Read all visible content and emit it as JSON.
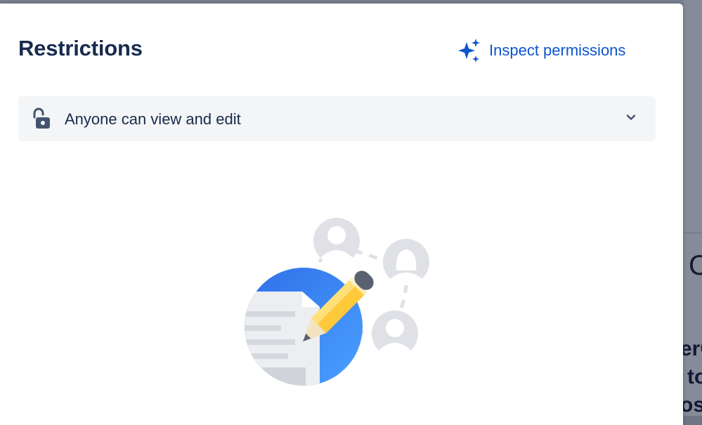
{
  "dialog": {
    "title": "Restrictions",
    "inspect_label": "Inspect permissions"
  },
  "restriction_select": {
    "value": "Anyone can view and edit"
  },
  "background_fragments": [
    "C",
    "erC",
    "to",
    "oss"
  ],
  "colors": {
    "accent": "#0c55cf",
    "title": "#172b4d",
    "select_bg": "#f4f5f7"
  },
  "icons": {
    "inspect": "sparkle-icon",
    "lock": "unlocked-padlock-icon",
    "chevron": "chevron-down-icon"
  }
}
